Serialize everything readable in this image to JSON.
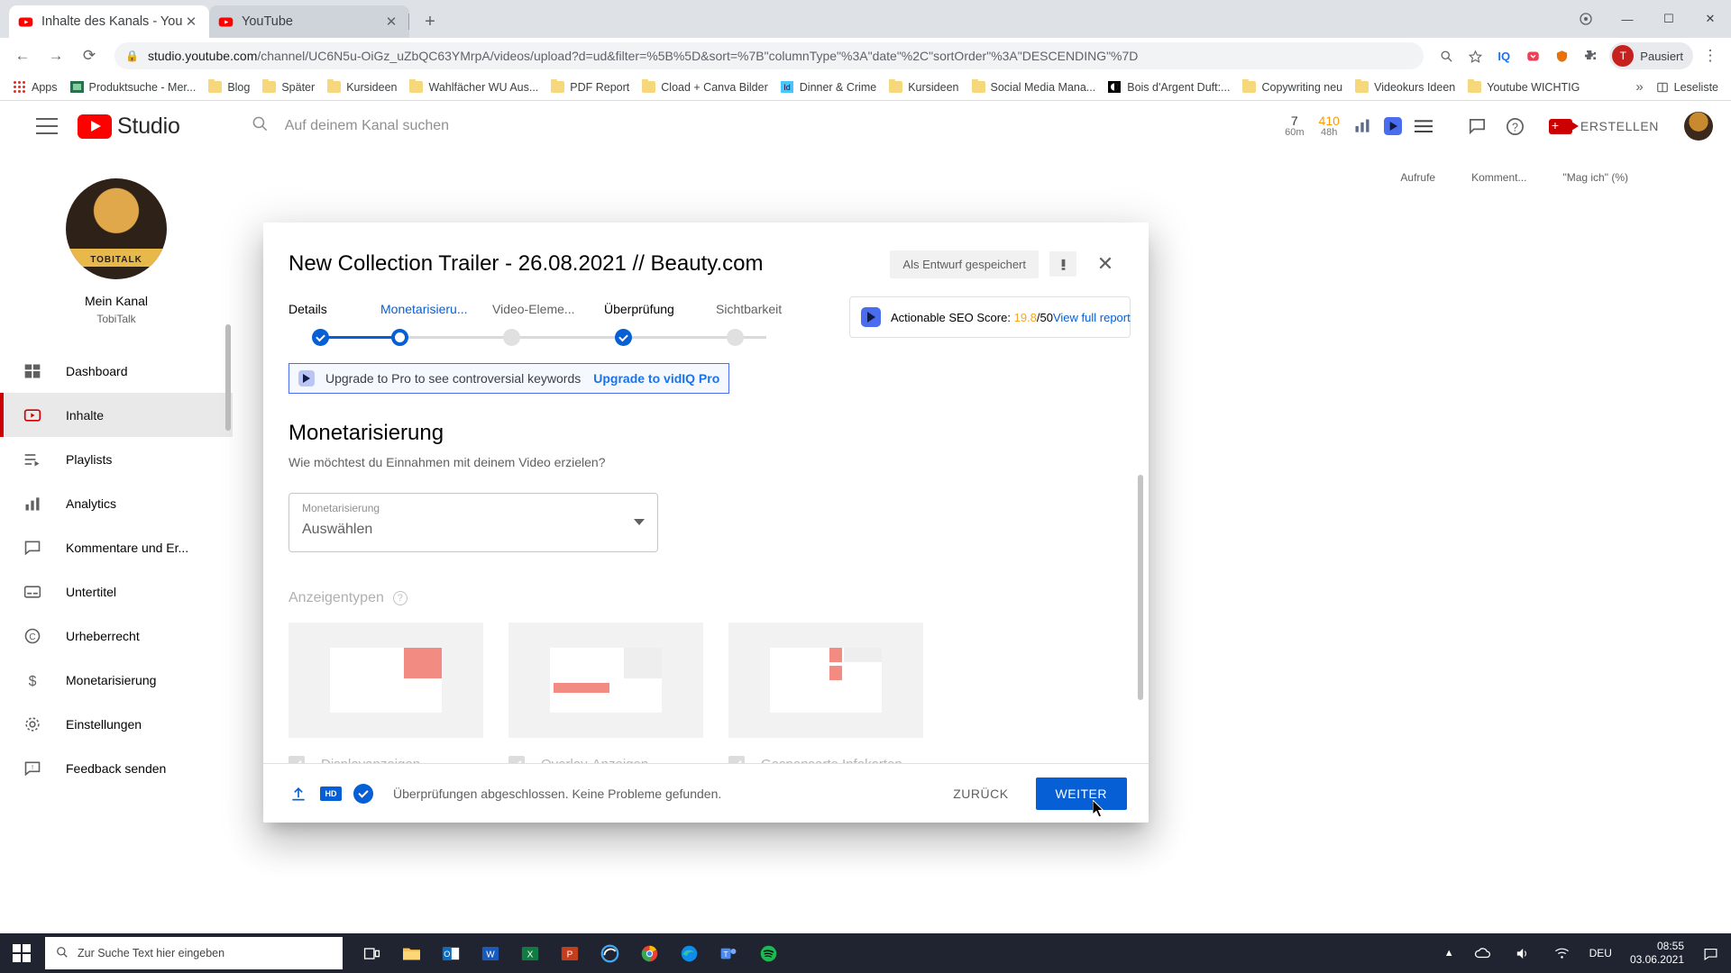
{
  "browser": {
    "tabs": [
      {
        "title": "Inhalte des Kanals - YouTube Stu",
        "favicon": "youtube-icon",
        "active": true
      },
      {
        "title": "YouTube",
        "favicon": "youtube-icon",
        "active": false
      }
    ],
    "new_tab_label": "+",
    "window_controls": {
      "minimize": "—",
      "maximize": "☐",
      "close": "✕"
    },
    "nav": {
      "back": "←",
      "forward": "→",
      "reload": "⟳"
    },
    "omnibox": {
      "lock_icon": "lock-icon",
      "url_main": "studio.youtube.com",
      "url_rest": "/channel/UC6N5u-OiGz_uZbQC63YMrpA/videos/upload?d=ud&filter=%5B%5D&sort=%7B\"columnType\"%3A\"date\"%2C\"sortOrder\"%3A\"DESCENDING\"%7D"
    },
    "omnibox_icons": [
      "zoom-icon",
      "star-icon"
    ],
    "extensions": [
      "iq-extension-icon",
      "pocket-extension-icon",
      "shield-extension-icon",
      "puzzle-extension-icon"
    ],
    "profile": {
      "initial": "T",
      "label": "Pausiert"
    },
    "menu_icon": "kebab-menu-icon",
    "bookmarks": [
      {
        "label": "Apps",
        "icon": "apps-grid-icon"
      },
      {
        "label": "Produktsuche - Mer...",
        "icon": "site-icon"
      },
      {
        "label": "Blog",
        "icon": "folder-icon"
      },
      {
        "label": "Später",
        "icon": "folder-icon"
      },
      {
        "label": "Kursideen",
        "icon": "folder-icon"
      },
      {
        "label": "Wahlfächer WU Aus...",
        "icon": "folder-icon"
      },
      {
        "label": "PDF Report",
        "icon": "folder-icon"
      },
      {
        "label": "Cload + Canva Bilder",
        "icon": "folder-icon"
      },
      {
        "label": "Dinner & Crime",
        "icon": "indesign-icon"
      },
      {
        "label": "Kursideen",
        "icon": "folder-icon"
      },
      {
        "label": "Social Media Mana...",
        "icon": "folder-icon"
      },
      {
        "label": "Bois d'Argent Duft:...",
        "icon": "dior-icon"
      },
      {
        "label": "Copywriting neu",
        "icon": "folder-icon"
      },
      {
        "label": "Videokurs Ideen",
        "icon": "folder-icon"
      },
      {
        "label": "Youtube WICHTIG",
        "icon": "folder-icon"
      }
    ],
    "bookmarks_overflow": "»",
    "reading_list": {
      "label": "Leseliste",
      "icon": "reading-list-icon"
    }
  },
  "studio": {
    "logo_text": "Studio",
    "search_placeholder": "Auf deinem Kanal suchen",
    "vidiq_metrics": [
      {
        "value": "7",
        "unit": "60m"
      },
      {
        "value": "410",
        "unit": "48h"
      }
    ],
    "header_icons": [
      "vidiq-stats-icon",
      "vidiq-logo-icon",
      "vidiq-menu-icon",
      "feedback-icon",
      "help-icon"
    ],
    "create_button": "ERSTELLEN",
    "channel": {
      "name": "Mein Kanal",
      "handle": "TobiTalk",
      "avatar_text": "TOBITALK"
    },
    "sidebar": [
      {
        "label": "Dashboard",
        "icon": "dashboard-icon",
        "active": false
      },
      {
        "label": "Inhalte",
        "icon": "content-video-icon",
        "active": true
      },
      {
        "label": "Playlists",
        "icon": "playlist-icon",
        "active": false
      },
      {
        "label": "Analytics",
        "icon": "analytics-icon",
        "active": false
      },
      {
        "label": "Kommentare und Er...",
        "icon": "comments-icon",
        "active": false
      },
      {
        "label": "Untertitel",
        "icon": "subtitles-icon",
        "active": false
      },
      {
        "label": "Urheberrecht",
        "icon": "copyright-icon",
        "active": false
      },
      {
        "label": "Monetarisierung",
        "icon": "monetization-icon",
        "active": false
      },
      {
        "label": "Einstellungen",
        "icon": "settings-gear-icon",
        "active": false
      },
      {
        "label": "Feedback senden",
        "icon": "feedback-send-icon",
        "active": false
      }
    ],
    "table_columns": [
      "Aufrufe",
      "Komment...",
      "\"Mag ich\" (%)"
    ]
  },
  "modal": {
    "title": "New Collection Trailer - 26.08.2021 // Beauty.com",
    "saved_chip": "Als Entwurf gespeichert",
    "warning_icon": "warning-icon",
    "close_icon": "close-icon",
    "steps": [
      {
        "label": "Details",
        "state": "done"
      },
      {
        "label": "Monetarisieru...",
        "state": "current"
      },
      {
        "label": "Video-Eleme...",
        "state": "pending"
      },
      {
        "label": "Überprüfung",
        "state": "done"
      },
      {
        "label": "Sichtbarkeit",
        "state": "pending"
      }
    ],
    "seo": {
      "icon": "vidiq-logo-icon",
      "label": "Actionable SEO Score:",
      "score": "19.8",
      "max": "/50",
      "link": "View full report",
      "score_color": "#f5a623"
    },
    "promo": {
      "icon": "vidiq-logo-icon",
      "text": "Upgrade to Pro to see controversial keywords",
      "link": "Upgrade to vidIQ Pro"
    },
    "section_title": "Monetarisierung",
    "section_sub": "Wie möchtest du Einnahmen mit deinem Video erzielen?",
    "select": {
      "label": "Monetarisierung",
      "value": "Auswählen",
      "arrow_icon": "chevron-down-icon"
    },
    "adtypes_label": "Anzeigentypen",
    "adtypes_help_icon": "help-circle-icon",
    "ad_options": [
      {
        "label": "Displayanzeigen",
        "checked": true
      },
      {
        "label": "Overlay-Anzeigen",
        "checked": true
      },
      {
        "label": "Gesponserte Infokarten",
        "checked": true
      }
    ],
    "footer": {
      "icons": [
        "upload-icon",
        "hd-badge-icon",
        "checks-complete-icon"
      ],
      "hd_label": "HD",
      "status": "Überprüfungen abgeschlossen. Keine Probleme gefunden.",
      "back_button": "ZURÜCK",
      "next_button": "WEITER"
    }
  },
  "taskbar": {
    "start_icon": "windows-start-icon",
    "search_placeholder": "Zur Suche Text hier eingeben",
    "search_icon": "search-icon",
    "apps": [
      {
        "name": "task-view-icon"
      },
      {
        "name": "file-explorer-icon"
      },
      {
        "name": "outlook-icon"
      },
      {
        "name": "word-icon"
      },
      {
        "name": "excel-icon"
      },
      {
        "name": "powerpoint-icon"
      },
      {
        "name": "edge-legacy-icon"
      },
      {
        "name": "chrome-icon"
      },
      {
        "name": "edge-icon"
      },
      {
        "name": "teams-icon"
      },
      {
        "name": "spotify-icon"
      }
    ],
    "tray": [
      "chevron-up-icon",
      "onedrive-icon",
      "volume-icon",
      "network-icon"
    ],
    "language": "DEU",
    "time": "08:55",
    "date": "03.06.2021",
    "notification_icon": "notification-icon"
  }
}
